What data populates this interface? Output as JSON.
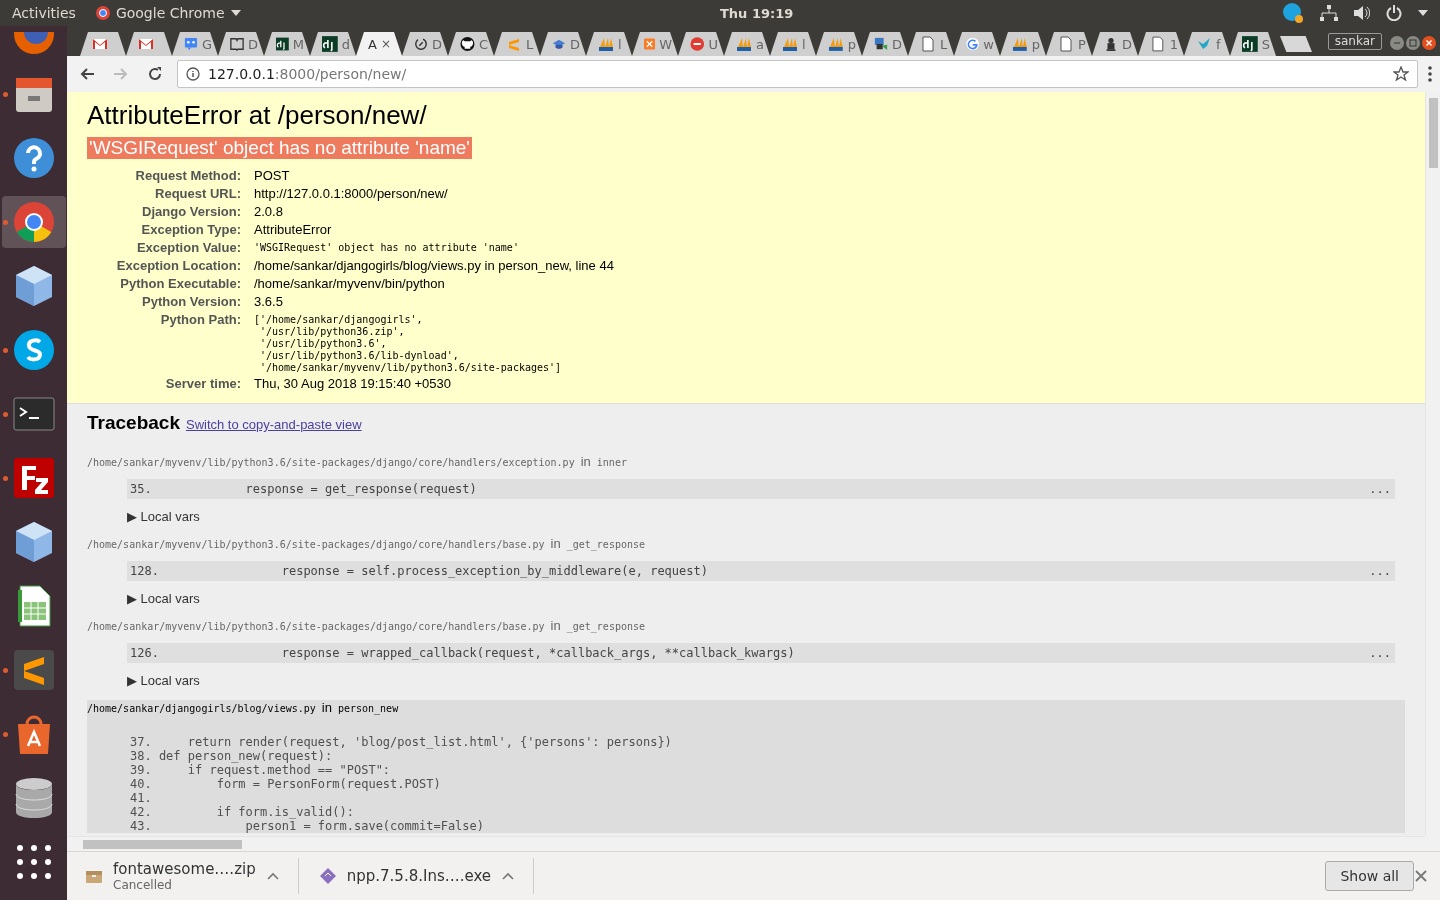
{
  "top_bar": {
    "activities": "Activities",
    "app_menu": "Google Chrome",
    "clock": "Thu 19:19"
  },
  "launcher": [
    {
      "kind": "fox",
      "running": false,
      "active": false
    },
    {
      "kind": "drawer",
      "running": true,
      "active": false
    },
    {
      "kind": "help",
      "running": false,
      "active": false
    },
    {
      "kind": "chrome",
      "running": true,
      "active": true
    },
    {
      "kind": "cube",
      "running": false,
      "active": false
    },
    {
      "kind": "chat",
      "running": true,
      "active": false
    },
    {
      "kind": "terminal",
      "running": true,
      "active": false
    },
    {
      "kind": "fz",
      "running": true,
      "active": false
    },
    {
      "kind": "cube",
      "running": false,
      "active": false
    },
    {
      "kind": "sheet",
      "running": false,
      "active": false
    },
    {
      "kind": "editor",
      "running": true,
      "active": false
    },
    {
      "kind": "bag",
      "running": true,
      "active": false
    },
    {
      "kind": "db",
      "running": false,
      "active": false
    },
    {
      "kind": "grid",
      "running": false,
      "active": false
    }
  ],
  "tabs": [
    {
      "kind": "mail",
      "selected": false
    },
    {
      "kind": "mail",
      "selected": false
    },
    {
      "kind": "chat-blue",
      "title": "G",
      "selected": false
    },
    {
      "kind": "book",
      "title": "D",
      "selected": false
    },
    {
      "kind": "dj",
      "title": "M",
      "selected": false
    },
    {
      "kind": "dj",
      "title": "d",
      "selected": false
    },
    {
      "kind": "none",
      "title": "A",
      "close": "×",
      "selected": true
    },
    {
      "kind": "ring",
      "title": "D",
      "selected": false
    },
    {
      "kind": "cat",
      "title": "C",
      "selected": false
    },
    {
      "kind": "s-orange",
      "title": "L",
      "selected": false
    },
    {
      "kind": "cap",
      "title": "D",
      "selected": false
    },
    {
      "kind": "pma",
      "title": "l",
      "selected": false
    },
    {
      "kind": "x-orange",
      "title": "W",
      "selected": false
    },
    {
      "kind": "ask",
      "title": "U",
      "selected": false
    },
    {
      "kind": "pma",
      "title": "a",
      "selected": false
    },
    {
      "kind": "pma",
      "title": "l",
      "selected": false
    },
    {
      "kind": "pma",
      "title": "p",
      "selected": false
    },
    {
      "kind": "lock",
      "title": "D",
      "selected": false
    },
    {
      "kind": "page",
      "title": "L",
      "selected": false
    },
    {
      "kind": "g",
      "title": "w",
      "selected": false
    },
    {
      "kind": "pma",
      "title": "p",
      "selected": false
    },
    {
      "kind": "page",
      "title": "P",
      "selected": false
    },
    {
      "kind": "emblem",
      "title": "D",
      "selected": false
    },
    {
      "kind": "page",
      "title": "1",
      "selected": false
    },
    {
      "kind": "bird",
      "title": "f",
      "selected": false
    },
    {
      "kind": "dj",
      "title": "S",
      "selected": false
    }
  ],
  "profile": "sankar",
  "address_bar": {
    "host": "127.0.0.1",
    "path": ":8000/person/new/"
  },
  "page": {
    "title": "AttributeError at /person/new/",
    "exception_value": "'WSGIRequest' object has no attribute 'name'",
    "meta": [
      {
        "label": "Request Method:",
        "value": "POST",
        "kind": "text"
      },
      {
        "label": "Request URL:",
        "value": "http://127.0.0.1:8000/person/new/",
        "kind": "text"
      },
      {
        "label": "Django Version:",
        "value": "2.0.8",
        "kind": "text"
      },
      {
        "label": "Exception Type:",
        "value": "AttributeError",
        "kind": "text"
      },
      {
        "label": "Exception Value:",
        "value": "'WSGIRequest' object has no attribute 'name'",
        "kind": "code"
      },
      {
        "label": "Exception Location:",
        "value": "/home/sankar/djangogirls/blog/views.py in person_new, line 44",
        "kind": "text"
      },
      {
        "label": "Python Executable:",
        "value": "/home/sankar/myvenv/bin/python",
        "kind": "text"
      },
      {
        "label": "Python Version:",
        "value": "3.6.5",
        "kind": "text"
      },
      {
        "label": "Python Path:",
        "value": "['/home/sankar/djangogirls',\n '/usr/lib/python36.zip',\n '/usr/lib/python3.6',\n '/usr/lib/python3.6/lib-dynload',\n '/home/sankar/myvenv/lib/python3.6/site-packages']",
        "kind": "code"
      },
      {
        "label": "Server time:",
        "value": "Thu, 30 Aug 2018 19:15:40 +0530",
        "kind": "text"
      }
    ],
    "traceback": {
      "heading": "Traceback",
      "link": "Switch to copy-and-paste view",
      "frames": [
        {
          "file": "/home/sankar/myvenv/lib/python3.6/site-packages/django/core/handlers/exception.py",
          "in": "in",
          "function": "inner",
          "user_code": false,
          "lines": [
            {
              "number": "35.",
              "code": "            response = get_response(request)",
              "current": true
            }
          ],
          "ellipsis": "...",
          "local_vars": "▶ Local vars"
        },
        {
          "file": "/home/sankar/myvenv/lib/python3.6/site-packages/django/core/handlers/base.py",
          "in": "in",
          "function": "_get_response",
          "user_code": false,
          "lines": [
            {
              "number": "128.",
              "code": "                 response = self.process_exception_by_middleware(e, request)",
              "current": true
            }
          ],
          "ellipsis": "...",
          "local_vars": "▶ Local vars"
        },
        {
          "file": "/home/sankar/myvenv/lib/python3.6/site-packages/django/core/handlers/base.py",
          "in": "in",
          "function": "_get_response",
          "user_code": false,
          "lines": [
            {
              "number": "126.",
              "code": "                 response = wrapped_callback(request, *callback_args, **callback_kwargs)",
              "current": true
            }
          ],
          "ellipsis": "...",
          "local_vars": "▶ Local vars"
        },
        {
          "file": "/home/sankar/djangogirls/blog/views.py",
          "in": "in",
          "function": "person_new",
          "user_code": true,
          "lines": [
            {
              "number": "37.",
              "code": "    return render(request, 'blog/post_list.html', {'persons': persons})",
              "current": false
            },
            {
              "number": "38.",
              "code": "def person_new(request):",
              "current": false
            },
            {
              "number": "39.",
              "code": "    if request.method == \"POST\":",
              "current": false
            },
            {
              "number": "40.",
              "code": "        form = PersonForm(request.POST)",
              "current": false
            },
            {
              "number": "41.",
              "current": false
            },
            {
              "number": "42.",
              "code": "        if form.is_valid():",
              "current": false
            },
            {
              "number": "43.",
              "code": "            person1 = form.save(commit=False)",
              "current": false
            }
          ]
        }
      ]
    }
  },
  "downloads": [
    {
      "kind": "archive",
      "name": "fontawesome….zip",
      "status": "Cancelled"
    },
    {
      "kind": "installer",
      "name": "npp.7.5.8.Ins….exe"
    }
  ],
  "show_all": "Show all"
}
